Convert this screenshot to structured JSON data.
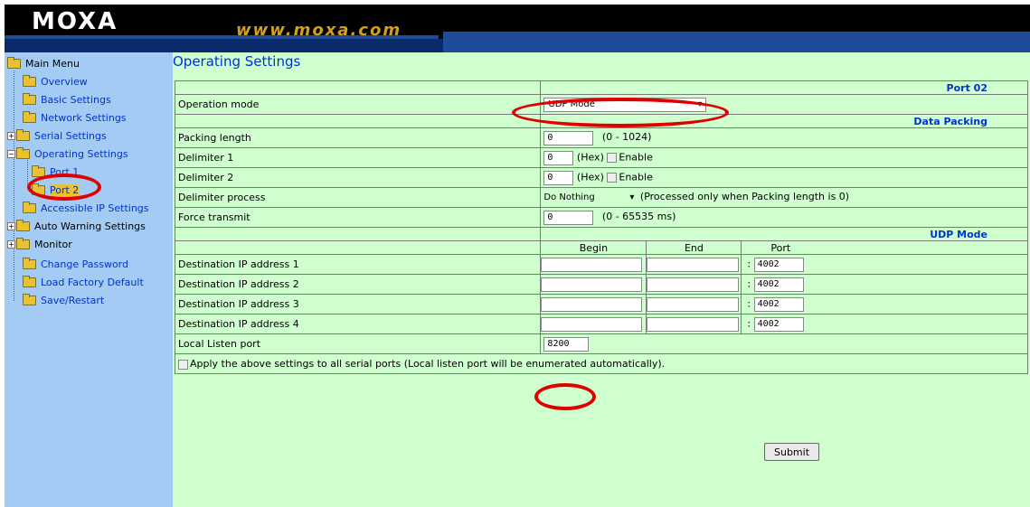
{
  "header": {
    "logo": "MOXA",
    "url": "www.moxa.com"
  },
  "sidebar": {
    "items": [
      {
        "label": "Main Menu"
      },
      {
        "label": "Overview"
      },
      {
        "label": "Basic Settings"
      },
      {
        "label": "Network Settings"
      },
      {
        "label": "Serial Settings"
      },
      {
        "label": "Operating Settings"
      },
      {
        "label": "Port 1"
      },
      {
        "label": "Port 2"
      },
      {
        "label": "Accessible IP Settings"
      },
      {
        "label": "Auto Warning Settings"
      },
      {
        "label": "Monitor"
      },
      {
        "label": "Change Password"
      },
      {
        "label": "Load Factory Default"
      },
      {
        "label": "Save/Restart"
      }
    ],
    "expander": "+",
    "collapser": "−"
  },
  "main": {
    "title": "Operating Settings",
    "port_header": "Port 02",
    "operation_mode_label": "Operation mode",
    "operation_mode_value": "UDP Mode",
    "data_packing_header": "Data Packing",
    "packing_length_label": "Packing length",
    "packing_length_value": "0",
    "packing_length_range": "(0 - 1024)",
    "delimiter1_label": "Delimiter 1",
    "delimiter1_value": "0",
    "delimiter2_label": "Delimiter 2",
    "delimiter2_value": "0",
    "hex_label": "(Hex)",
    "enable_label": "Enable",
    "delimiter_process_label": "Delimiter process",
    "delimiter_process_value": "Do Nothing",
    "delimiter_process_note": "(Processed only when Packing length is 0)",
    "force_transmit_label": "Force transmit",
    "force_transmit_value": "0",
    "force_transmit_range": "(0 - 65535 ms)",
    "udp_mode_header": "UDP Mode",
    "col_begin": "Begin",
    "col_end": "End",
    "col_port": "Port",
    "destinations": [
      {
        "label": "Destination IP address 1",
        "begin": "",
        "end": "",
        "port": "4002"
      },
      {
        "label": "Destination IP address 2",
        "begin": "",
        "end": "",
        "port": "4002"
      },
      {
        "label": "Destination IP address 3",
        "begin": "",
        "end": "",
        "port": "4002"
      },
      {
        "label": "Destination IP address 4",
        "begin": "",
        "end": "",
        "port": "4002"
      }
    ],
    "colon": ":",
    "local_listen_port_label": "Local Listen port",
    "local_listen_port_value": "8200",
    "apply_all_label": "Apply the above settings to all serial ports (Local listen port will be enumerated automatically).",
    "submit_label": "Submit"
  },
  "colors": {
    "sidebar_bg": "#a3cbf3",
    "main_bg": "#cfffcf",
    "header_bg": "#000000",
    "link_blue": "#0033cc",
    "annotation_red": "#e00000"
  }
}
